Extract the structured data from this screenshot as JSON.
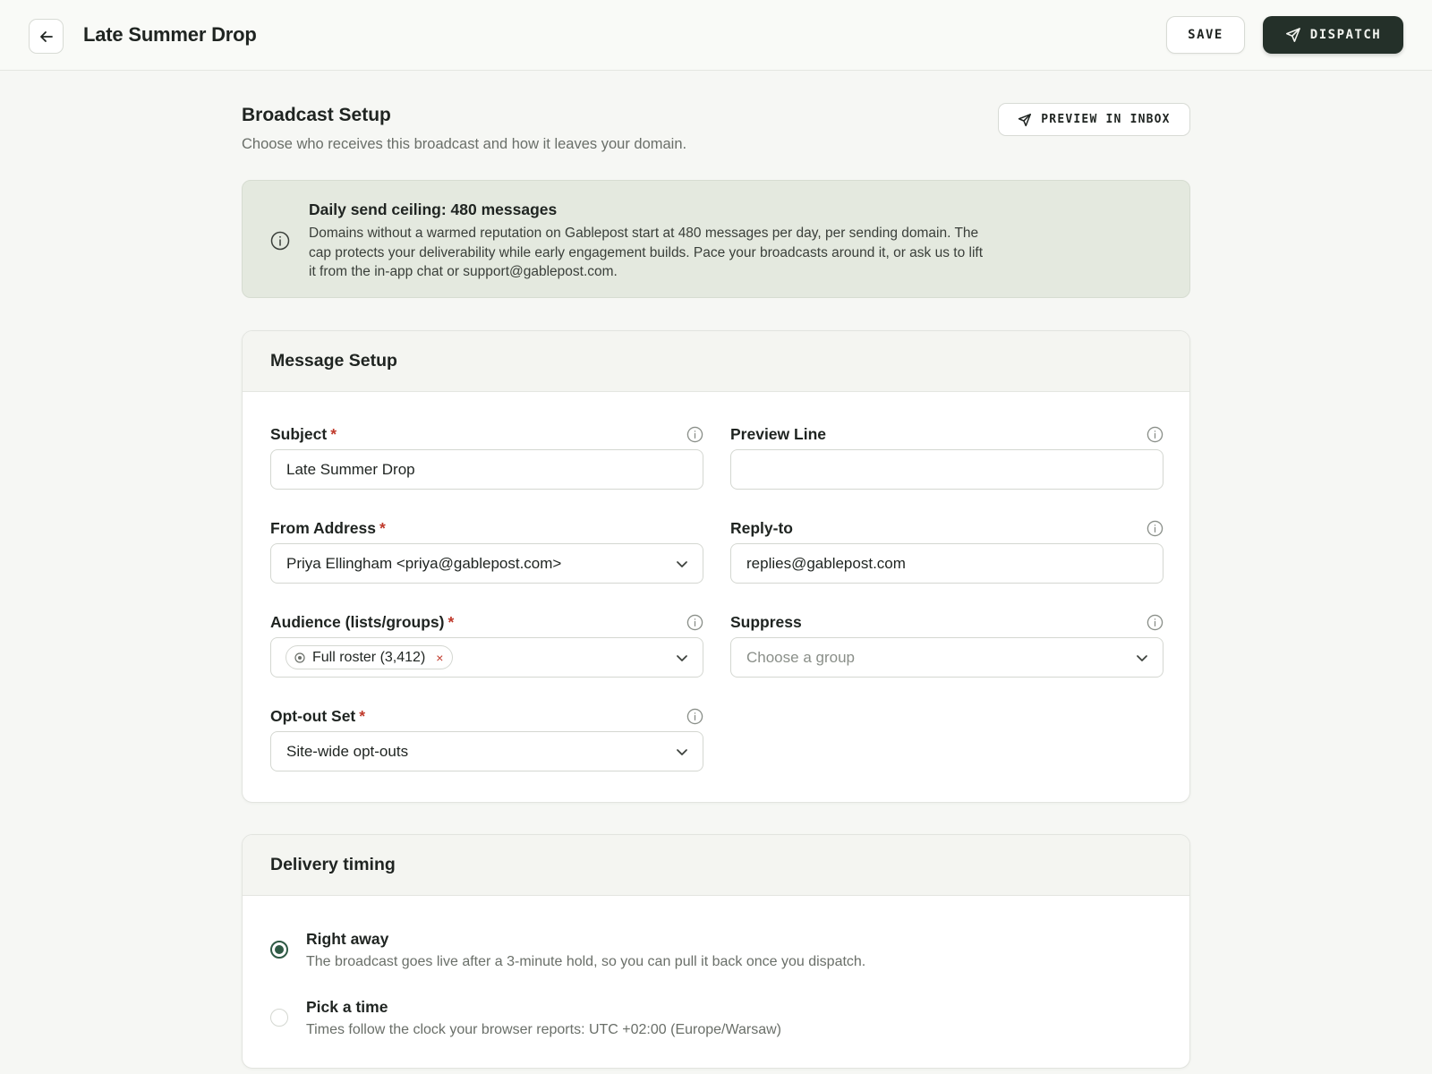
{
  "header": {
    "title": "Late Summer Drop",
    "save_label": "SAVE",
    "dispatch_label": "DISPATCH"
  },
  "broadcast": {
    "title": "Broadcast Setup",
    "subtitle": "Choose who receives this broadcast and how it leaves your domain.",
    "preview_label": "PREVIEW IN INBOX"
  },
  "notice": {
    "title": "Daily send ceiling: 480 messages",
    "body": "Domains without a warmed reputation on Gablepost start at 480 messages per day, per sending domain. The cap protects your deliverability while early engagement builds. Pace your broadcasts around it, or ask us to lift it from the in-app chat or support@gablepost.com."
  },
  "message_setup": {
    "title": "Message Setup",
    "required_mark": "*",
    "subject": {
      "label": "Subject",
      "value": "Late Summer Drop"
    },
    "preview_line": {
      "label": "Preview Line",
      "value": ""
    },
    "from_address": {
      "label": "From Address",
      "value": "Priya Ellingham <priya@gablepost.com>"
    },
    "reply_to": {
      "label": "Reply-to",
      "value": "replies@gablepost.com"
    },
    "audience": {
      "label": "Audience (lists/groups)",
      "chip": "Full roster (3,412)",
      "chip_remove": "×"
    },
    "suppress": {
      "label": "Suppress",
      "placeholder": "Choose a group"
    },
    "opt_out": {
      "label": "Opt-out Set",
      "value": "Site-wide opt-outs"
    }
  },
  "delivery": {
    "title": "Delivery timing",
    "options": [
      {
        "title": "Right away",
        "desc": "The broadcast goes live after a 3-minute hold, so you can pull it back once you dispatch.",
        "selected": true
      },
      {
        "title": "Pick a time",
        "desc": "Times follow the clock your browser reports: UTC +02:00 (Europe/Warsaw)",
        "selected": false
      }
    ]
  },
  "colors": {
    "accent": "#243029",
    "required": "#c0392b",
    "radio_selected": "#2f5a45",
    "notice_bg": "#e4e9df"
  }
}
